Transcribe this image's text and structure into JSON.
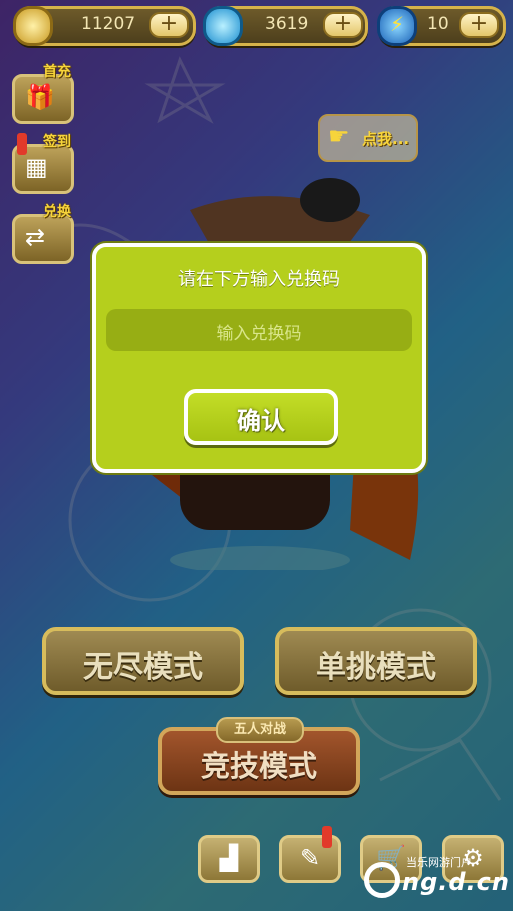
{
  "resources": {
    "coins": "11207",
    "diamonds": "3619",
    "energy": "10",
    "plus": "+"
  },
  "side_menu": {
    "first_recharge": "首充",
    "sign_in": "签到",
    "redeem": "兑换"
  },
  "tap_hint": "点我...",
  "modal": {
    "title": "请在下方输入兑换码",
    "input_placeholder": "输入兑换码",
    "confirm": "确认"
  },
  "modes": {
    "endless": "无尽模式",
    "duel": "单挑模式",
    "arena_tag": "五人对战",
    "arena": "竞技模式"
  },
  "watermark": {
    "top": "当乐网游门户",
    "big": "ng.d.cn"
  },
  "colors": {
    "modal": "#b5cf1d",
    "mode_button": "#8a7640",
    "arena_button": "#8b4621"
  }
}
